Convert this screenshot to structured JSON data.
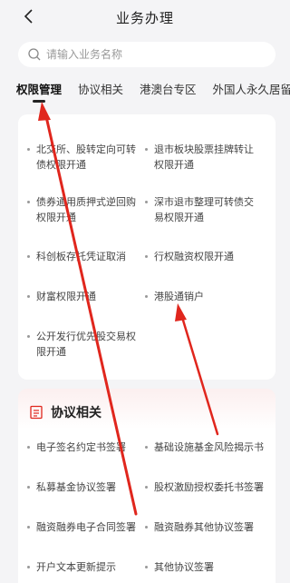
{
  "header": {
    "title": "业务办理"
  },
  "search": {
    "placeholder": "请输入业务名称"
  },
  "tabs": [
    {
      "label": "权限管理"
    },
    {
      "label": "协议相关"
    },
    {
      "label": "港澳台专区"
    },
    {
      "label": "外国人永久居留"
    }
  ],
  "permissions": {
    "items": [
      {
        "label": "北交所、股转定向可转债权限开通"
      },
      {
        "label": "退市板块股票挂牌转让权限开通"
      },
      {
        "label": "债券通用质押式逆回购权限开通"
      },
      {
        "label": "深市退市整理可转债交易权限开通"
      },
      {
        "label": "科创板存托凭证取消"
      },
      {
        "label": "行权融资权限开通"
      },
      {
        "label": "财富权限开通"
      },
      {
        "label": "港股通销户"
      },
      {
        "label": "公开发行优先股交易权限开通"
      }
    ]
  },
  "agreements": {
    "title": "协议相关",
    "items": [
      {
        "label": "电子签名约定书签署"
      },
      {
        "label": "基础设施基金风险揭示书"
      },
      {
        "label": "私募基金协议签署"
      },
      {
        "label": "股权激励授权委托书签署"
      },
      {
        "label": "融资融券电子合同签署"
      },
      {
        "label": "融资融券其他协议签署"
      },
      {
        "label": "开户文本更新提示"
      },
      {
        "label": "其他协议签署"
      }
    ]
  },
  "colors": {
    "annotation_arrow": "#e0261d",
    "background": "#f4f4f6"
  }
}
